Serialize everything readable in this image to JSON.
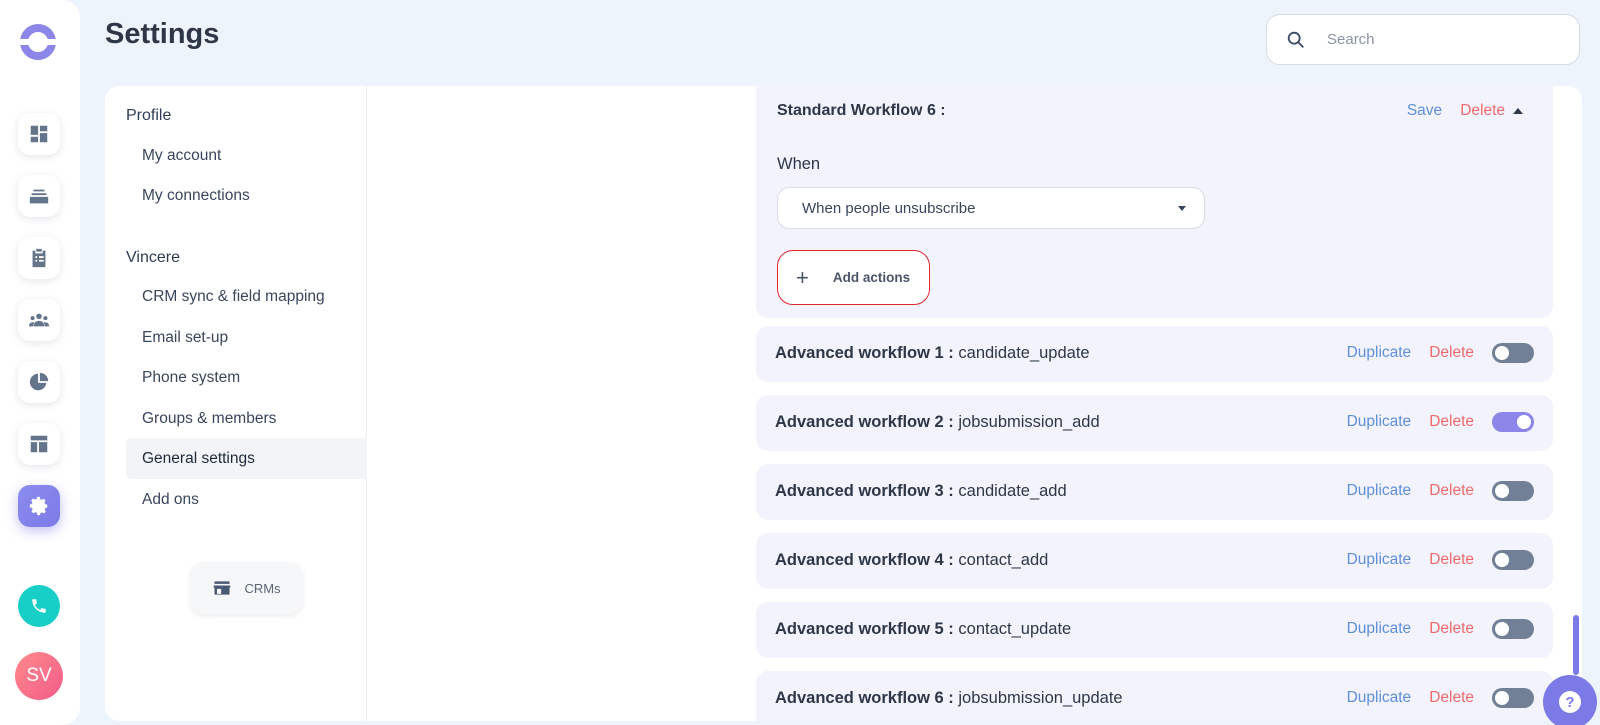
{
  "header": {
    "title": "Settings",
    "search_placeholder": "Search"
  },
  "rail": {
    "avatar_initials": "SV",
    "icons": [
      "dashboard-icon",
      "stack-icon",
      "clipboard-icon",
      "people-icon",
      "pie-chart-icon",
      "layout-icon",
      "gear-icon",
      "phone-icon"
    ]
  },
  "nav": {
    "group_profile": "Profile",
    "my_account": "My account",
    "my_connections": "My connections",
    "group_vincere": "Vincere",
    "crm_sync": "CRM sync & field mapping",
    "email_setup": "Email set-up",
    "phone_system": "Phone system",
    "groups_members": "Groups & members",
    "general_settings": "General settings",
    "add_ons": "Add ons",
    "crms_button": "CRMs"
  },
  "standard_workflow": {
    "title": "Standard Workflow 6 :",
    "save": "Save",
    "delete": "Delete",
    "when_label": "When",
    "trigger": "When people unsubscribe",
    "add_actions": "Add actions"
  },
  "workflows": [
    {
      "name": "Advanced workflow 1 :",
      "event": "candidate_update",
      "duplicate": "Duplicate",
      "delete": "Delete",
      "enabled": false
    },
    {
      "name": "Advanced workflow 2 :",
      "event": "jobsubmission_add",
      "duplicate": "Duplicate",
      "delete": "Delete",
      "enabled": true
    },
    {
      "name": "Advanced workflow 3 :",
      "event": "candidate_add",
      "duplicate": "Duplicate",
      "delete": "Delete",
      "enabled": false
    },
    {
      "name": "Advanced workflow 4 :",
      "event": "contact_add",
      "duplicate": "Duplicate",
      "delete": "Delete",
      "enabled": false
    },
    {
      "name": "Advanced workflow 5 :",
      "event": "contact_update",
      "duplicate": "Duplicate",
      "delete": "Delete",
      "enabled": false
    },
    {
      "name": "Advanced workflow 6 :",
      "event": "jobsubmission_update",
      "duplicate": "Duplicate",
      "delete": "Delete",
      "enabled": false
    }
  ],
  "colors": {
    "accent": "#7c7ae6",
    "link_blue": "#5f8fd8",
    "link_red": "#f06a6a",
    "highlight_border": "#e0262b"
  }
}
